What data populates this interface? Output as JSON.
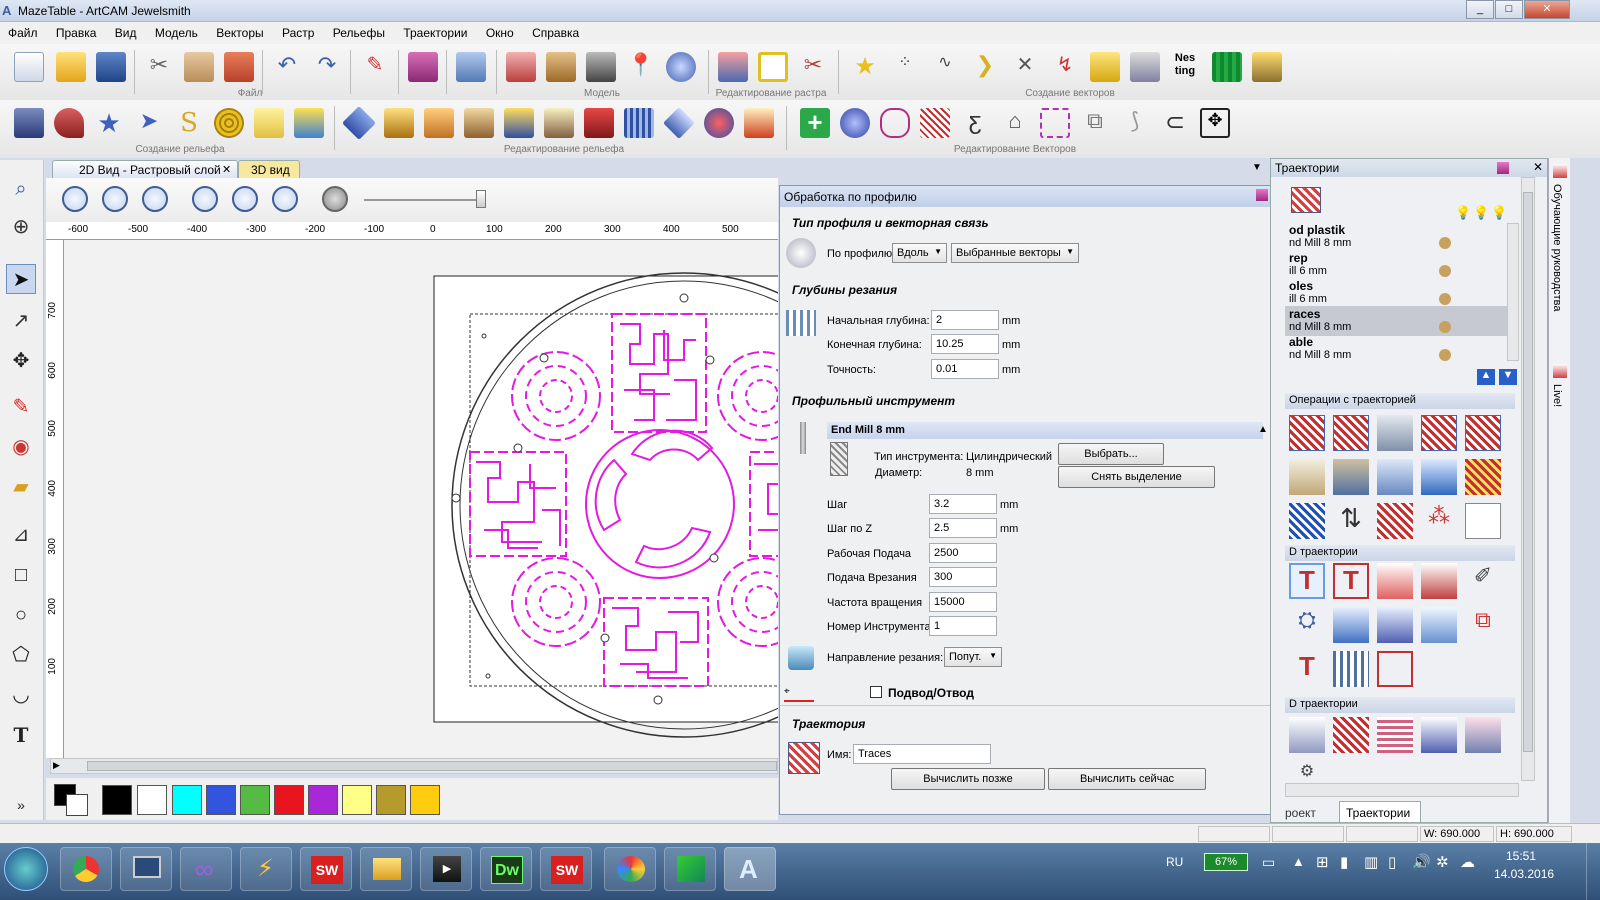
{
  "window": {
    "title": "MazeTable - ArtCAM Jewelsmith",
    "min": "_",
    "max": "□",
    "close": "✕"
  },
  "menu": [
    "Файл",
    "Правка",
    "Вид",
    "Модель",
    "Векторы",
    "Растр",
    "Рельефы",
    "Траектории",
    "Окно",
    "Справка"
  ],
  "toolbar_groups": {
    "file": "Файл",
    "model": "Модель",
    "raster_edit": "Редактирование растра",
    "vector_create": "Создание векторов",
    "relief_create": "Создание рельефа",
    "relief_edit": "Редактирование рельефа",
    "vector_edit": "Редактирование Векторов"
  },
  "nesting_label": "Nes\nting",
  "view_tabs": [
    {
      "label": "2D Вид - Растровый слой",
      "active": true
    },
    {
      "label": "3D вид",
      "active": false
    }
  ],
  "ruler_h": [
    "-600",
    "-500",
    "-400",
    "-300",
    "-200",
    "-100",
    "0",
    "100",
    "200",
    "300",
    "400",
    "500"
  ],
  "ruler_v": [
    "700",
    "600",
    "500",
    "400",
    "300",
    "200",
    "100"
  ],
  "colors": [
    "#000000",
    "#ffffff",
    "#00ffff",
    "#3355dd",
    "#55bb44",
    "#e8141e",
    "#a828d8",
    "#ffff88",
    "#b49b2c",
    "#ffcc10"
  ],
  "canvas_colors": {
    "maze": "#e21ae2",
    "outline": "#333333"
  },
  "profile_panel": {
    "title": "Обработка по профилю",
    "close": "✕",
    "sec_profile": "Тип профиля и векторная связь",
    "profile_label": "По профилю",
    "profile_side": "Вдоль",
    "profile_vectors": "Выбранные векторы",
    "sec_depths": "Глубины резания",
    "start_depth_label": "Начальная глубина:",
    "start_depth": "2",
    "end_depth_label": "Конечная глубина:",
    "end_depth": "10.25",
    "tolerance_label": "Точность:",
    "tolerance": "0.01",
    "unit_mm": "mm",
    "sec_tool": "Профильный инструмент",
    "tool_name": "End Mill 8 mm",
    "tool_type_label": "Тип инструмента:",
    "tool_type": "Цилиндрический",
    "diameter_label": "Диаметр:",
    "diameter": "8 mm",
    "select_btn": "Выбрать...",
    "deselect_btn": "Снять выделение",
    "stepover_label": "Шаг",
    "stepover": "3.2",
    "stepz_label": "Шаг по Z",
    "stepz": "2.5",
    "feed_label": "Рабочая Подача",
    "feed": "2500",
    "plunge_label": "Подача Врезания",
    "plunge": "300",
    "spindle_label": "Частота вращения",
    "spindle": "15000",
    "toolno_label": "Номер Инструмента",
    "toolno": "1",
    "direction_label": "Направление резания:",
    "direction": "Попут.",
    "leadin_label": "Подвод/Отвод",
    "sec_toolpath": "Траектория",
    "name_label": "Имя:",
    "name": "Traces",
    "calc_later": "Вычислить позже",
    "calc_now": "Вычислить сейчас"
  },
  "toolpaths_panel": {
    "title": "Траектории",
    "items": [
      {
        "name": "od plastik",
        "tool": "nd Mill 8 mm"
      },
      {
        "name": "rep",
        "tool": "ill 6 mm"
      },
      {
        "name": "oles",
        "tool": "ill 6 mm"
      },
      {
        "name": "races",
        "tool": "nd Mill 8 mm"
      },
      {
        "name": "able",
        "tool": "nd Mill 8 mm"
      }
    ],
    "ops_group": "Операции с траекторией",
    "group_2d": "D траектории",
    "group_3d": "D траектории",
    "tab_project": "роект",
    "tab_toolpaths": "Траектории"
  },
  "side_tabs": {
    "tutorials": "Обучающие руководства",
    "live": "Live!"
  },
  "status": {
    "w": "W: 690.000",
    "h": "H: 690.000"
  },
  "taskbar": {
    "lang": "RU",
    "battery": "67%",
    "time": "15:51",
    "date": "14.03.2016",
    "app_sw": "SW",
    "app_dw": "Dw"
  }
}
